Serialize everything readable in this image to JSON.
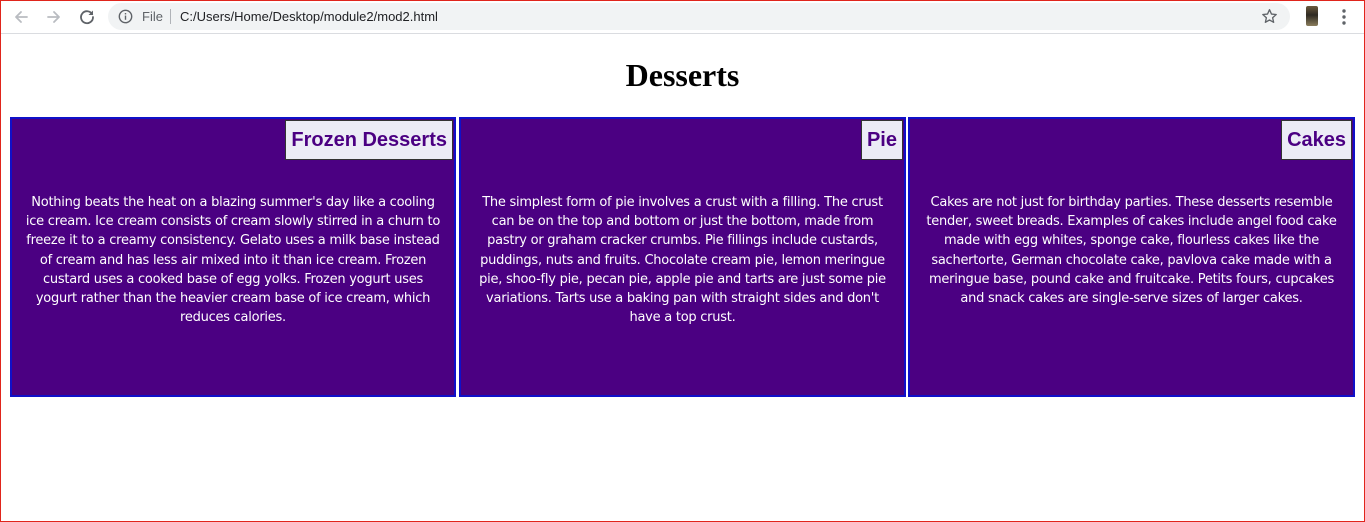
{
  "browser": {
    "back_icon": "arrow-left-icon",
    "forward_icon": "arrow-right-icon",
    "reload_icon": "reload-icon",
    "scheme_label": "File",
    "url": "C:/Users/Home/Desktop/module2/mod2.html",
    "bookmark_icon": "star-icon",
    "menu_icon": "more-vert-icon"
  },
  "page": {
    "title": "Desserts"
  },
  "colors": {
    "card_background": "#4b0082",
    "card_border": "#1010c8",
    "heading_background": "#ececf6",
    "heading_text": "#4b0082"
  },
  "cards": [
    {
      "heading": "Frozen Desserts",
      "text": "Nothing beats the heat on a blazing summer's day like a cooling ice cream. Ice cream consists of cream slowly stirred in a churn to freeze it to a creamy consistency. Gelato uses a milk base instead of cream and has less air mixed into it than ice cream. Frozen custard uses a cooked base of egg yolks. Frozen yogurt uses yogurt rather than the heavier cream base of ice cream, which reduces calories."
    },
    {
      "heading": "Pie",
      "text": "The simplest form of pie involves a crust with a filling. The crust can be on the top and bottom or just the bottom, made from pastry or graham cracker crumbs. Pie fillings include custards, puddings, nuts and fruits. Chocolate cream pie, lemon meringue pie, shoo-fly pie, pecan pie, apple pie and tarts are just some pie variations. Tarts use a baking pan with straight sides and don't have a top crust."
    },
    {
      "heading": "Cakes",
      "text": "Cakes are not just for birthday parties. These desserts resemble tender, sweet breads. Examples of cakes include angel food cake made with egg whites, sponge cake, flourless cakes like the sachertorte, German chocolate cake, pavlova cake made with a meringue base, pound cake and fruitcake. Petits fours, cupcakes and snack cakes are single-serve sizes of larger cakes."
    }
  ]
}
